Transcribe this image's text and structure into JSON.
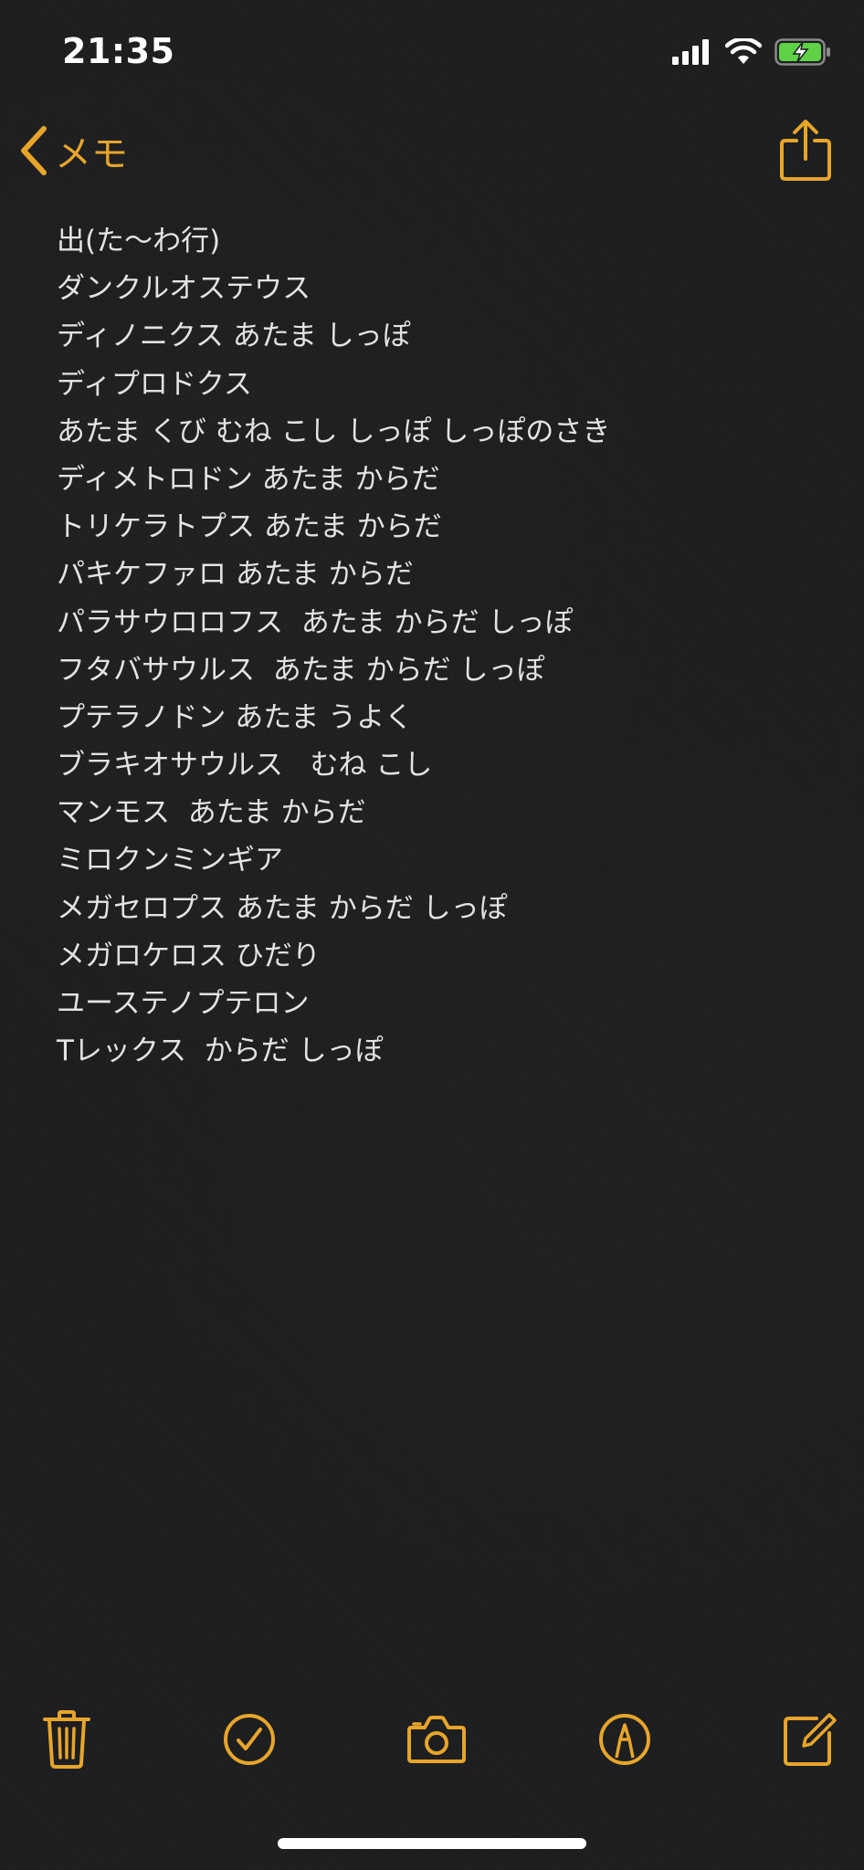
{
  "status_bar": {
    "time": "21:35",
    "icons": [
      "cellular-signal-icon",
      "wifi-icon",
      "battery-charging-icon"
    ]
  },
  "nav": {
    "back_label": "メモ",
    "back_icon": "chevron-left-icon",
    "share_icon": "share-icon"
  },
  "note": {
    "lines": [
      "出(た〜わ行)",
      "ダンクルオステウス",
      "ディノニクス あたま しっぽ",
      "ディプロドクス",
      "あたま くび むね こし しっぽ しっぽのさき",
      "ディメトロドン あたま からだ",
      "トリケラトプス あたま からだ",
      "パキケファロ あたま からだ",
      "パラサウロロフス  あたま からだ しっぽ",
      "フタバサウルス  あたま からだ しっぽ",
      "プテラノドン あたま うよく",
      "ブラキオサウルス   むね こし",
      "マンモス  あたま からだ",
      "ミロクンミンギア",
      "メガセロプス あたま からだ しっぽ",
      "メガロケロス ひだり",
      "ユーステノプテロン",
      "Tレックス  からだ しっぽ"
    ]
  },
  "toolbar": {
    "items": [
      {
        "name": "trash-button",
        "icon": "trash-icon"
      },
      {
        "name": "checklist-button",
        "icon": "checkmark-circle-icon"
      },
      {
        "name": "camera-button",
        "icon": "camera-icon"
      },
      {
        "name": "markup-button",
        "icon": "pen-circle-icon"
      },
      {
        "name": "compose-button",
        "icon": "compose-icon"
      }
    ]
  },
  "colors": {
    "accent": "#e7a52a",
    "background": "#1c1d1f",
    "text": "#e3e3e3",
    "battery": "#5fd146"
  }
}
